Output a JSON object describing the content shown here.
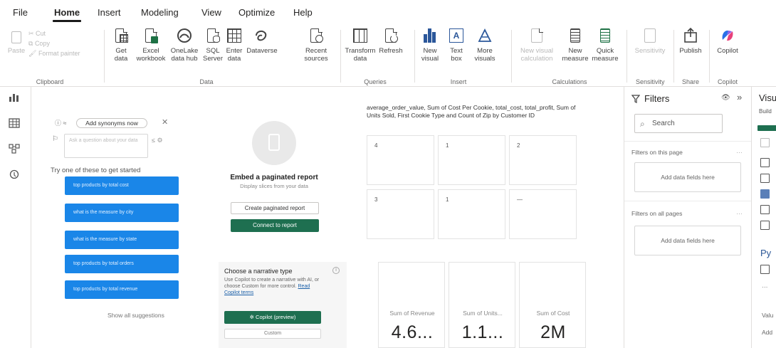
{
  "menu": {
    "tabs": [
      "File",
      "Home",
      "Insert",
      "Modeling",
      "View",
      "Optimize",
      "Help"
    ],
    "active": "Home"
  },
  "ribbon": {
    "clipboard": {
      "paste": "Paste",
      "cut": "Cut",
      "copy": "Copy",
      "format_painter": "Format painter",
      "label": "Clipboard"
    },
    "data": {
      "get_data": "Get data",
      "excel": "Excel workbook",
      "onelake": "OneLake data hub",
      "sql": "SQL Server",
      "enter": "Enter data",
      "dataverse": "Dataverse",
      "recent": "Recent sources",
      "label": "Data"
    },
    "queries": {
      "transform": "Transform data",
      "refresh": "Refresh",
      "label": "Queries"
    },
    "insert": {
      "new_visual": "New visual",
      "text_box": "Text box",
      "more_visuals": "More visuals",
      "label": "Insert"
    },
    "calculations": {
      "new_visual_calc": "New visual calculation",
      "new_measure": "New measure",
      "quick_measure": "Quick measure",
      "label": "Calculations"
    },
    "sensitivity": {
      "btn": "Sensitivity",
      "label": "Sensitivity"
    },
    "share": {
      "publish": "Publish",
      "label": "Share"
    },
    "copilot": {
      "btn": "Copilot",
      "label": "Copilot"
    }
  },
  "qna": {
    "pill": "Add synonyms now",
    "input_placeholder": "Ask a question about your data",
    "hint": "Try one of these to get started",
    "suggestions": [
      "top products by total cost",
      "what is the measure by city",
      "what is the measure by state",
      "top products by total orders",
      "top products by total revenue"
    ],
    "show_all": "Show all suggestions"
  },
  "paginated": {
    "title": "Embed a paginated report",
    "subtitle": "Display slices from your data",
    "create_btn": "Create paginated report",
    "connect_btn": "Connect to report"
  },
  "narrative": {
    "title": "Choose a narrative type",
    "body": "Use Copilot to create a narrative with AI, or choose Custom for more control.",
    "link": "Read Copilot terms",
    "copilot_btn": "Copilot (preview)",
    "custom_btn": "Custom"
  },
  "table_visual": {
    "title": "average_order_value, Sum of Cost Per Cookie, total_cost, total_profit, Sum of Units Sold, First Cookie Type and Count of Zip by Customer ID",
    "cells": [
      "4",
      "1",
      "2",
      "3",
      "1",
      "—"
    ]
  },
  "cards": [
    {
      "label": "Sum of Revenue",
      "value": "4.6..."
    },
    {
      "label": "Sum of Units...",
      "value": "1.1..."
    },
    {
      "label": "Sum of Cost",
      "value": "2M"
    }
  ],
  "filters": {
    "title": "Filters",
    "search_placeholder": "Search",
    "on_page": "Filters on this page",
    "on_all": "Filters on all pages",
    "drop_here": "Add data fields here"
  },
  "viz_pane": {
    "title": "Visu",
    "build": "Build",
    "py": "Py",
    "values": "Valu",
    "add": "Add"
  }
}
